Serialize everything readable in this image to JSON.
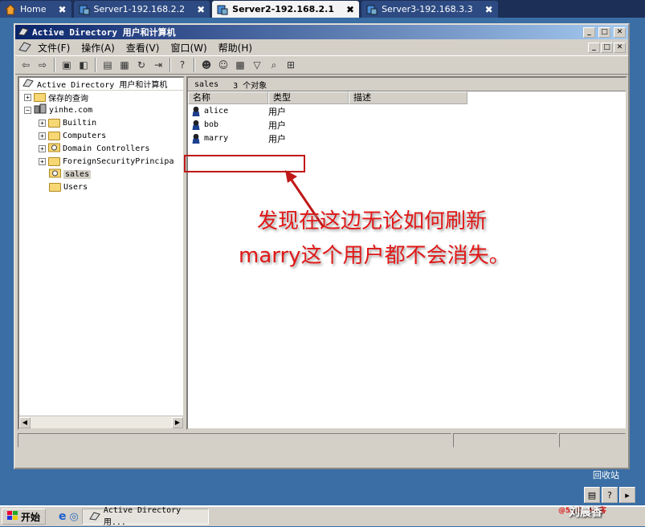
{
  "tabs": [
    {
      "label": "Home",
      "active": false
    },
    {
      "label": "Server1-192.168.2.2",
      "active": false
    },
    {
      "label": "Server2-192.168.2.1",
      "active": true
    },
    {
      "label": "Server3-192.168.3.3",
      "active": false
    }
  ],
  "tab_close_glyph": "✖",
  "window": {
    "title": "Active Directory 用户和计算机",
    "controls": {
      "minimize": "_",
      "maximize": "□",
      "close": "✕"
    }
  },
  "menu": [
    {
      "label": "文件(F)"
    },
    {
      "label": "操作(A)"
    },
    {
      "label": "查看(V)"
    },
    {
      "label": "窗口(W)"
    },
    {
      "label": "帮助(H)"
    }
  ],
  "tree": {
    "root": "Active Directory 用户和计算机",
    "saved_queries": "保存的查询",
    "domain": "yinhe.com",
    "children": [
      "Builtin",
      "Computers",
      "Domain Controllers",
      "ForeignSecurityPrincipa",
      "sales",
      "Users"
    ]
  },
  "pane": {
    "title": "sales",
    "count": "3 个对象",
    "columns": [
      "名称",
      "类型",
      "描述"
    ],
    "rows": [
      {
        "name": "alice",
        "type": "用户"
      },
      {
        "name": "bob",
        "type": "用户"
      },
      {
        "name": "marry",
        "type": "用户"
      }
    ]
  },
  "annotation": {
    "line1": "发现在这边无论如何刷新",
    "line2": "marry这个用户都不会消失。",
    "color": "#e01818"
  },
  "desktop": {
    "recycle_bin": "回收站"
  },
  "taskbar": {
    "start": "开始",
    "task": "Active Directory 用...",
    "watermark": "刘晨香",
    "site": "@51CTO博客"
  }
}
